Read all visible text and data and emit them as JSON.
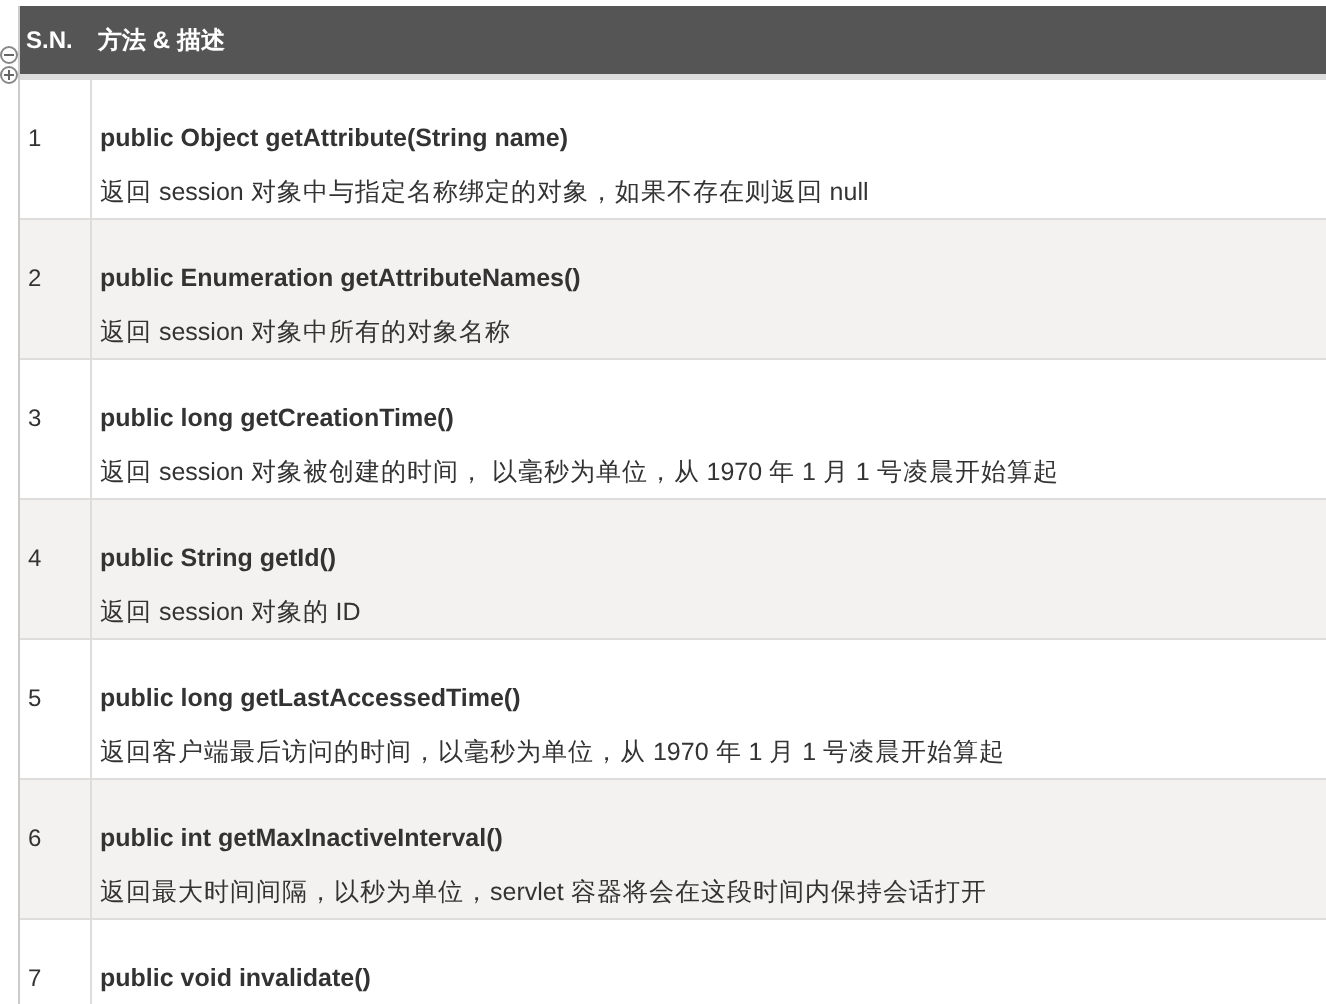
{
  "table": {
    "columns": [
      "S.N.",
      "方法 & 描述"
    ],
    "rows": [
      {
        "sn": "1",
        "method": "public Object getAttribute(String name)",
        "description": "返回 session 对象中与指定名称绑定的对象，如果不存在则返回 null"
      },
      {
        "sn": "2",
        "method": "public Enumeration getAttributeNames()",
        "description": "返回 session 对象中所有的对象名称"
      },
      {
        "sn": "3",
        "method": "public long getCreationTime()",
        "description": "返回 session 对象被创建的时间， 以毫秒为单位，从 1970 年 1 月 1 号凌晨开始算起"
      },
      {
        "sn": "4",
        "method": "public String getId()",
        "description": "返回 session 对象的 ID"
      },
      {
        "sn": "5",
        "method": "public long getLastAccessedTime()",
        "description": "返回客户端最后访问的时间，以毫秒为单位，从 1970 年 1 月 1 号凌晨开始算起"
      },
      {
        "sn": "6",
        "method": "public int getMaxInactiveInterval()",
        "description": "返回最大时间间隔，以秒为单位，servlet 容器将会在这段时间内保持会话打开"
      },
      {
        "sn": "7",
        "method": "public void invalidate()"
      }
    ]
  }
}
